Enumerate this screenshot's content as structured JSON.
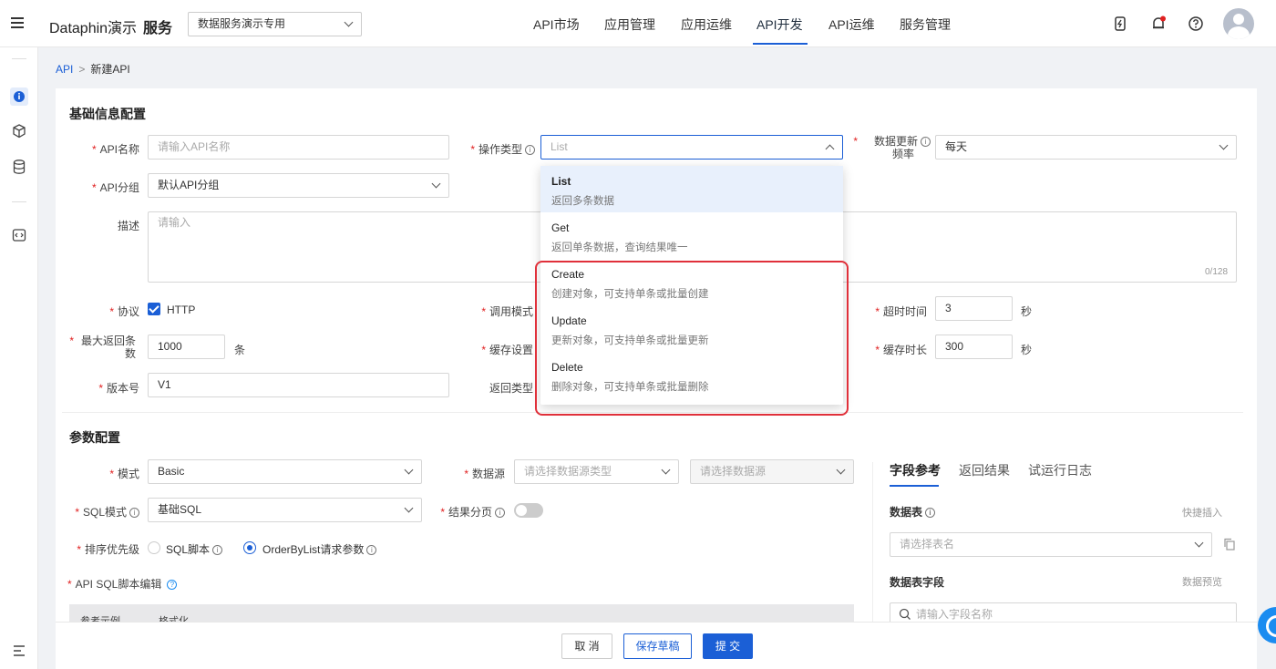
{
  "topbar": {
    "brand": "Dataphin演示",
    "module": "服务",
    "project": "数据服务演示专用",
    "nav": [
      "API市场",
      "应用管理",
      "应用运维",
      "API开发",
      "API运维",
      "服务管理"
    ],
    "active_nav": "API开发"
  },
  "breadcrumb": {
    "root": "API",
    "sep": ">",
    "current": "新建API"
  },
  "basic": {
    "title": "基础信息配置",
    "api_name_label": "API名称",
    "api_name_placeholder": "请输入API名称",
    "op_type_label": "操作类型",
    "op_type_value": "List",
    "update_freq_label_1": "数据更新",
    "update_freq_label_2": "频率",
    "update_freq_value": "每天",
    "group_label": "API分组",
    "group_value": "默认API分组",
    "desc_label": "描述",
    "desc_placeholder": "请输入",
    "desc_counter": "0/128",
    "protocol_label": "协议",
    "protocol_value": "HTTP",
    "call_mode_label": "调用模式",
    "timeout_label": "超时时间",
    "timeout_value": "3",
    "timeout_unit": "秒",
    "max_rows_label_1": "最大返回条",
    "max_rows_label_2": "数",
    "max_rows_value": "1000",
    "max_rows_unit": "条",
    "cache_label": "缓存设置",
    "cache_duration_label": "缓存时长",
    "cache_duration_value": "300",
    "cache_duration_unit": "秒",
    "version_label": "版本号",
    "version_value": "V1",
    "return_type_label": "返回类型"
  },
  "params": {
    "title": "参数配置",
    "mode_label": "模式",
    "mode_value": "Basic",
    "datasource_label": "数据源",
    "datasource_type_placeholder": "请选择数据源类型",
    "datasource_placeholder": "请选择数据源",
    "sql_mode_label": "SQL模式",
    "sql_mode_value": "基础SQL",
    "paging_label": "结果分页",
    "sort_label": "排序优先级",
    "sort_opt1": "SQL脚本",
    "sort_opt2": "OrderByList请求参数",
    "sql_editor_label": "API SQL脚本编辑",
    "editor_ref": "参考示例",
    "editor_format": "格式化"
  },
  "side": {
    "tabs": [
      "字段参考",
      "返回结果",
      "试运行日志"
    ],
    "table_label": "数据表",
    "quick_insert": "快捷插入",
    "table_placeholder": "请选择表名",
    "fields_label": "数据表字段",
    "preview": "数据预览",
    "field_search_placeholder": "请输入字段名称"
  },
  "dropdown": {
    "items": [
      {
        "name": "List",
        "desc": "返回多条数据"
      },
      {
        "name": "Get",
        "desc": "返回单条数据，查询结果唯一"
      },
      {
        "name": "Create",
        "desc": "创建对象，可支持单条或批量创建"
      },
      {
        "name": "Update",
        "desc": "更新对象，可支持单条或批量更新"
      },
      {
        "name": "Delete",
        "desc": "删除对象，可支持单条或批量删除"
      }
    ]
  },
  "footer": {
    "cancel": "取 消",
    "save_draft": "保存草稿",
    "submit": "提 交"
  },
  "colors": {
    "primary": "#1b5fd6",
    "highlight": "#e0303a"
  }
}
